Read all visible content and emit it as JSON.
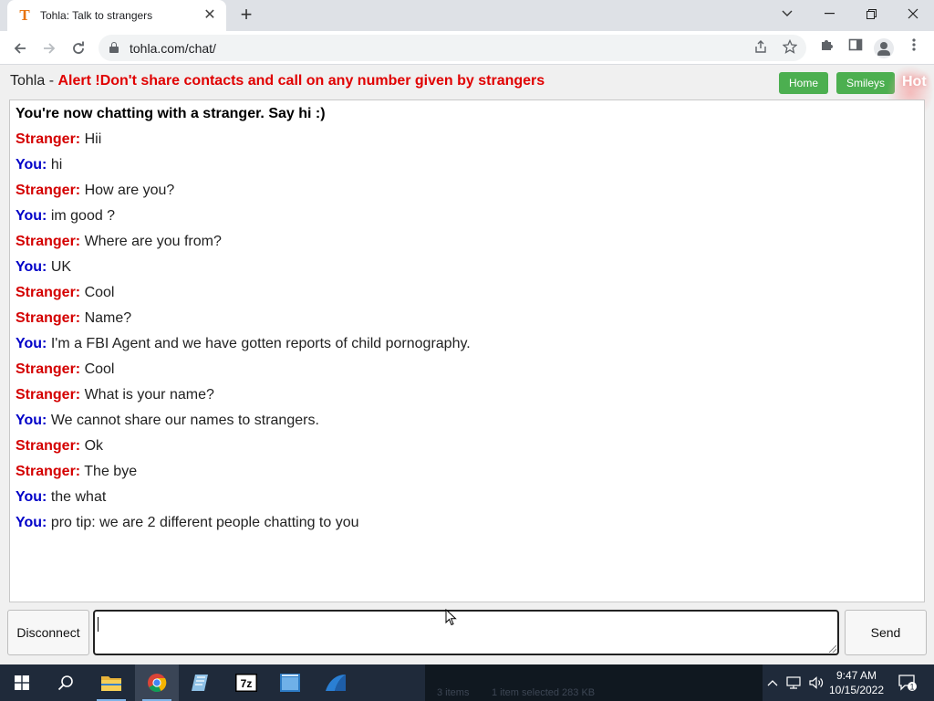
{
  "browser": {
    "tab_title": "Tohla: Talk to strangers",
    "tab_favicon": "T",
    "url": "tohla.com/chat/"
  },
  "page": {
    "site_name": "Tohla - ",
    "alert": "Alert !Don't share contacts and call on any number given by strangers",
    "nav": {
      "home": "Home",
      "smileys": "Smileys",
      "hot": "Hot"
    },
    "system_message": "You're now chatting with a stranger. Say hi :)",
    "messages": [
      {
        "who": "Stranger:",
        "role": "stranger",
        "text": "Hii"
      },
      {
        "who": "You:",
        "role": "you",
        "text": "hi"
      },
      {
        "who": "Stranger:",
        "role": "stranger",
        "text": "How are you?"
      },
      {
        "who": "You:",
        "role": "you",
        "text": "im good ?"
      },
      {
        "who": "Stranger:",
        "role": "stranger",
        "text": "Where are you from?"
      },
      {
        "who": "You:",
        "role": "you",
        "text": "UK"
      },
      {
        "who": "Stranger:",
        "role": "stranger",
        "text": "Cool"
      },
      {
        "who": "Stranger:",
        "role": "stranger",
        "text": "Name?"
      },
      {
        "who": "You:",
        "role": "you",
        "text": "I'm a FBI Agent and we have gotten reports of child pornography."
      },
      {
        "who": "Stranger:",
        "role": "stranger",
        "text": "Cool"
      },
      {
        "who": "Stranger:",
        "role": "stranger",
        "text": "What is your name?"
      },
      {
        "who": "You:",
        "role": "you",
        "text": "We cannot share our names to strangers."
      },
      {
        "who": "Stranger:",
        "role": "stranger",
        "text": "Ok"
      },
      {
        "who": "Stranger:",
        "role": "stranger",
        "text": "The bye"
      },
      {
        "who": "You:",
        "role": "you",
        "text": "the what"
      },
      {
        "who": "You:",
        "role": "you",
        "text": "pro tip: we are 2 different people chatting to you"
      }
    ],
    "disconnect_label": "Disconnect",
    "send_label": "Send",
    "input_value": ""
  },
  "taskbar": {
    "ghost_items": "3 items",
    "ghost_selected": "1 item selected  283 KB",
    "time": "9:47 AM",
    "date": "10/15/2022",
    "notification_count": "1"
  },
  "colors": {
    "alert": "#e00000",
    "stranger": "#d40000",
    "you": "#0000c8",
    "button_green": "#4caf50"
  }
}
